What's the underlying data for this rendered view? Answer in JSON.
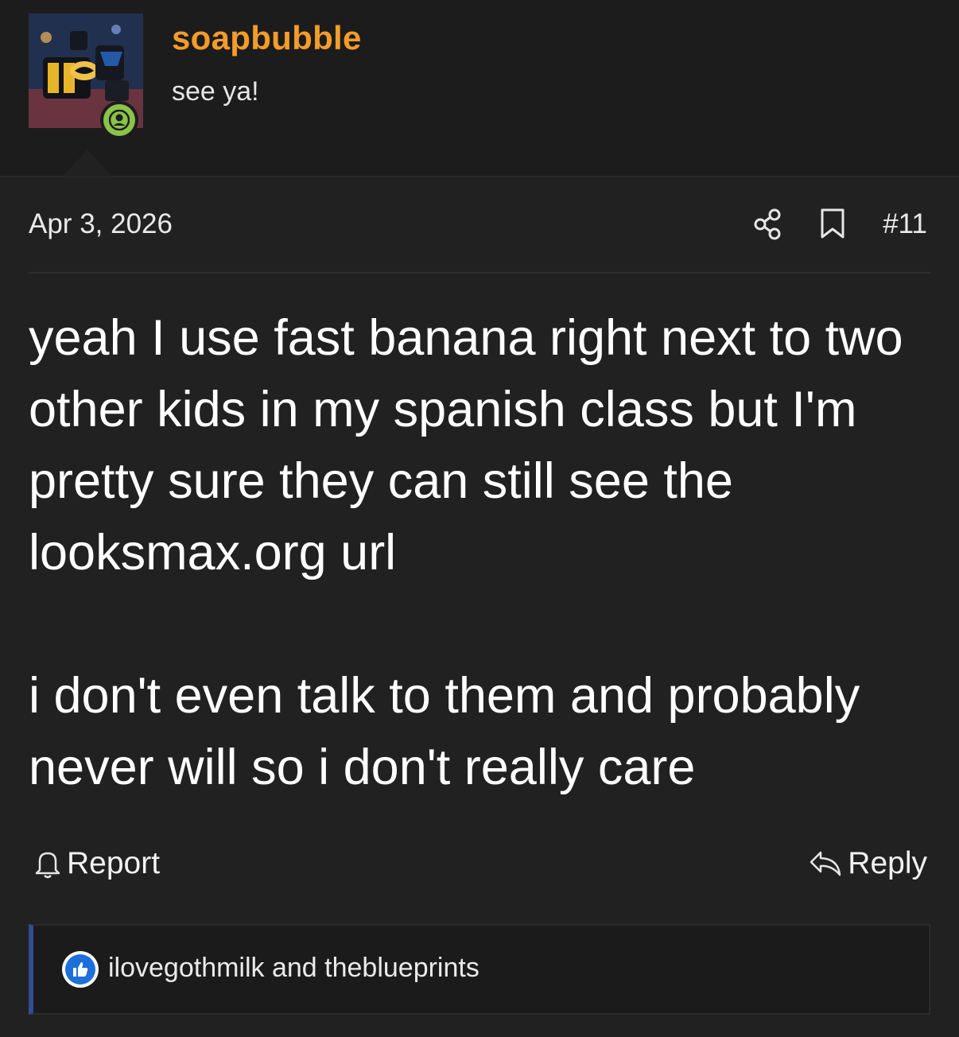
{
  "post": {
    "author": {
      "username": "soapbubble",
      "status": "see ya!",
      "online": true,
      "accent_color": "#f39c2b",
      "online_color": "#8bc34a"
    },
    "date": "Apr 3, 2026",
    "number": "#11",
    "icons": [
      "share-icon",
      "bookmark-icon"
    ],
    "body": {
      "paragraph_1": "yeah I use fast banana right next to two other kids in my spanish class but I'm pretty sure they can still see the looksmax.org url",
      "paragraph_2": "i don't even talk to them and probably never will so i don't really care"
    },
    "actions": {
      "report_label": "Report",
      "reply_label": "Reply"
    },
    "reactions": {
      "users_text": "ilovegothmilk and theblueprints",
      "icon": "like-icon",
      "color": "#1e6fd9"
    }
  }
}
